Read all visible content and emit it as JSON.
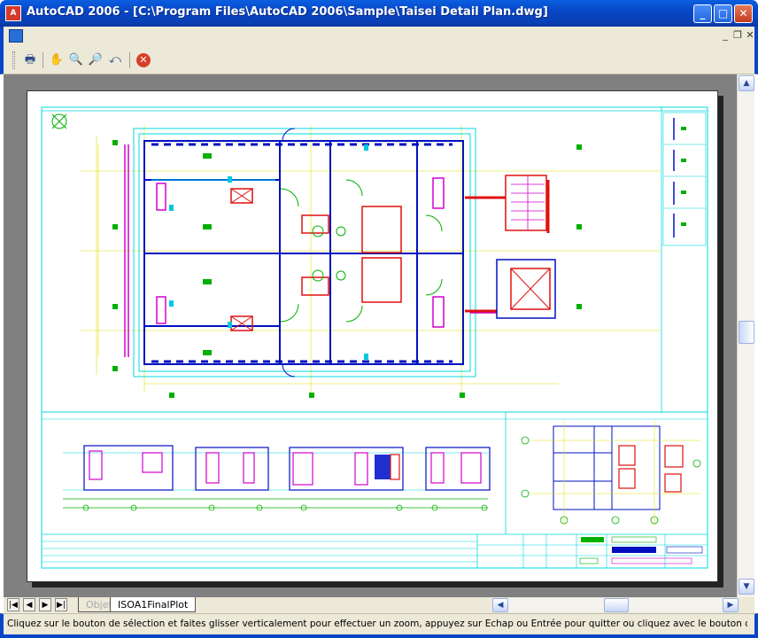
{
  "window": {
    "title": "AutoCAD 2006 - [C:\\Program Files\\AutoCAD 2006\\Sample\\Taisei Detail Plan.dwg]",
    "app_icon": "autocad-logo-icon",
    "controls": {
      "minimize": "_",
      "maximize": "□",
      "close": "✕"
    }
  },
  "mdi_controls": {
    "minimize": "_",
    "restore": "❐",
    "close": "✕"
  },
  "toolbar": {
    "tools": [
      {
        "name": "plot-icon",
        "glyph": "🖶"
      },
      {
        "name": "pan-icon",
        "glyph": "✋"
      },
      {
        "name": "zoom-realtime-icon",
        "glyph": "🔍"
      },
      {
        "name": "zoom-window-icon",
        "glyph": "🔎"
      },
      {
        "name": "zoom-previous-icon",
        "glyph": "⤺"
      },
      {
        "name": "close-preview-icon",
        "glyph": "✕"
      }
    ]
  },
  "tabs": {
    "nav": [
      "|◀",
      "◀",
      "▶",
      "▶|"
    ],
    "model": "Objet",
    "layout": "ISOA1FinalPlot"
  },
  "scroll": {
    "up": "▲",
    "down": "▼",
    "left": "◀",
    "right": "▶"
  },
  "status": {
    "message": "Cliquez sur le bouton de sélection et faites glisser verticalement pour effectuer un zoom, appuyez sur Echap ou Entrée pour quitter ou cliquez avec le bouton droit de la souris"
  },
  "colors": {
    "title_blue": "#0846c7",
    "canvas_gray": "#808080",
    "cyan": "#00e0e8",
    "green": "#00b000",
    "red": "#e01010",
    "magenta": "#d000d0",
    "blue": "#0010c0",
    "yellow": "#e0e000"
  }
}
